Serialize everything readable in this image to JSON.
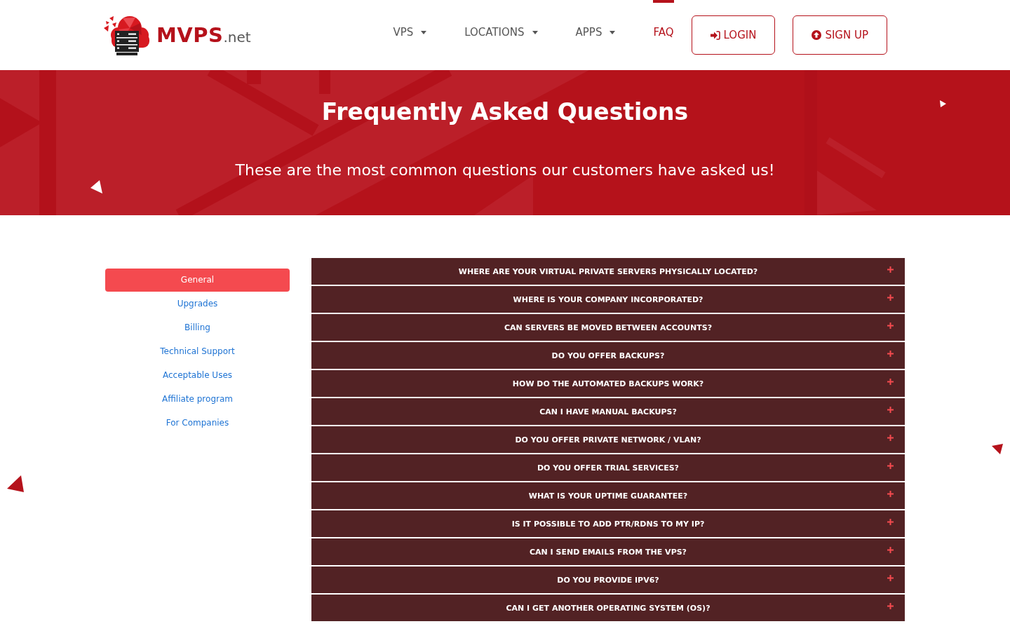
{
  "header": {
    "logo": {
      "name": "MVPS",
      "suffix": ".net"
    },
    "nav": [
      {
        "label": "VPS",
        "dropdown": true,
        "selected": false
      },
      {
        "label": "LOCATIONS",
        "dropdown": true,
        "selected": false
      },
      {
        "label": "APPS",
        "dropdown": true,
        "selected": false
      },
      {
        "label": "FAQ",
        "dropdown": false,
        "selected": true
      }
    ],
    "buttons": [
      {
        "label": "LOGIN",
        "kind": "login"
      },
      {
        "label": "SIGN UP",
        "kind": "signup"
      }
    ]
  },
  "hero": {
    "title": "Frequently Asked Questions",
    "subtitle": "These are the most common questions our customers have asked us!"
  },
  "categories": [
    {
      "label": "General",
      "selected": true
    },
    {
      "label": "Upgrades",
      "selected": false
    },
    {
      "label": "Billing",
      "selected": false
    },
    {
      "label": "Technical Support",
      "selected": false
    },
    {
      "label": "Acceptable Uses",
      "selected": false
    },
    {
      "label": "Affiliate program",
      "selected": false
    },
    {
      "label": "For Companies",
      "selected": false
    }
  ],
  "faq": [
    {
      "question": "WHERE ARE YOUR VIRTUAL PRIVATE SERVERS PHYSICALLY LOCATED?",
      "expanded": false
    },
    {
      "question": "WHERE IS YOUR COMPANY INCORPORATED?",
      "expanded": false
    },
    {
      "question": "CAN SERVERS BE MOVED BETWEEN ACCOUNTS?",
      "expanded": false
    },
    {
      "question": "DO YOU OFFER BACKUPS?",
      "expanded": false
    },
    {
      "question": "HOW DO THE AUTOMATED BACKUPS WORK?",
      "expanded": false
    },
    {
      "question": "CAN I HAVE MANUAL BACKUPS?",
      "expanded": false
    },
    {
      "question": "DO YOU OFFER PRIVATE NETWORK / VLAN?",
      "expanded": false
    },
    {
      "question": "DO YOU OFFER TRIAL SERVICES?",
      "expanded": false
    },
    {
      "question": "WHAT IS YOUR UPTIME GUARANTEE?",
      "expanded": false
    },
    {
      "question": "IS IT POSSIBLE TO ADD PTR/RDNS TO MY IP?",
      "expanded": false
    },
    {
      "question": "CAN I SEND EMAILS FROM THE VPS?",
      "expanded": false
    },
    {
      "question": "DO YOU PROVIDE IPV6?",
      "expanded": false
    },
    {
      "question": "CAN I GET ANOTHER OPERATING SYSTEM (OS)?",
      "expanded": false
    }
  ]
}
